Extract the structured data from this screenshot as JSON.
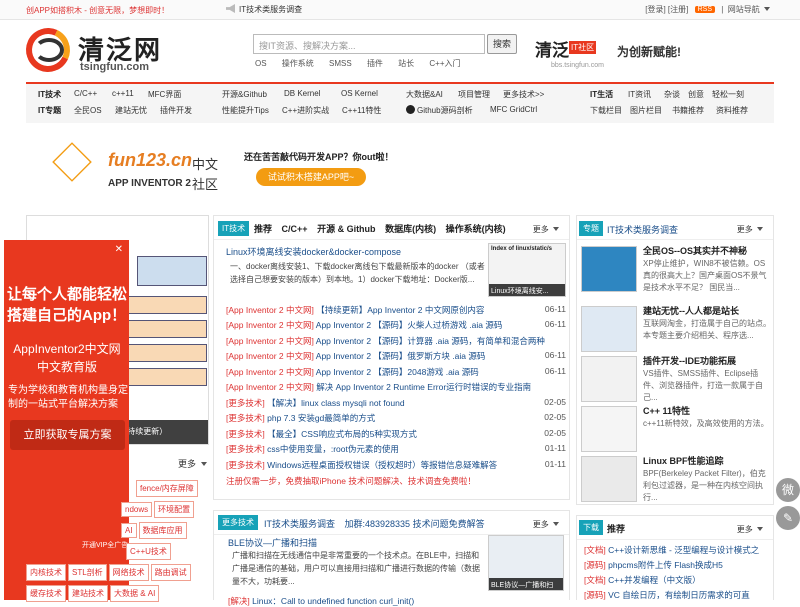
{
  "topbar": {
    "promo": "创APP如搭积木 - 创意无限，梦想即时！",
    "survey": "IT技术类服务调查",
    "login": "[登录]",
    "register": "[注册]",
    "rss": "RSS",
    "site_nav": "网站导航"
  },
  "header": {
    "logo_cn": "清泛网",
    "logo_domain": "tsingfun.com",
    "search_placeholder": "搜IT资源、搜解决方案...",
    "search_button": "搜索",
    "hot_keywords": [
      "OS",
      "操作系统",
      "SMSS",
      "插件",
      "站长",
      "C++入门"
    ],
    "community_cn": "清泛",
    "community_tag": "IT社区",
    "community_slogan": "为创新赋能!",
    "community_url": "bbs.tsingfun.com"
  },
  "nav": {
    "row1": {
      "label": "IT技术",
      "items": [
        "C/C++",
        "c++11",
        "MFC界面",
        "开源&Github",
        "DB Kernel",
        "OS Kernel",
        "大数据&AI",
        "项目管理",
        "更多技术>>"
      ],
      "right_label": "IT生活",
      "right_items": [
        "IT资讯",
        "杂谈",
        "创意",
        "轻松一刻"
      ]
    },
    "row2": {
      "label": "IT专题",
      "items": [
        "全民OS",
        "建站无忧",
        "插件开发",
        "性能提升Tips",
        "C++进阶实战",
        "C++11特性",
        "Github源码剖析",
        "MFC GridCtrl"
      ],
      "right_items": [
        "下载栏目",
        "图片栏目",
        "书籍推荐",
        "资料推荐"
      ]
    }
  },
  "banner": {
    "brand": "fun123.cn",
    "brand_sub": "APP INVENTOR 2",
    "cn1": "中文",
    "cn2": "社区",
    "question": "还在苦苦敲代码开发APP？你out啦！",
    "button": "试试积木搭建APP吧~"
  },
  "left": {
    "image_caption": "Linux bpftrace学习笔记（持续更新）",
    "more": "更多",
    "tags": [
      "fence/内存屏障",
      "ndows",
      "环境配置",
      "AI",
      "数据库应用",
      "C++U技术",
      "内核技术",
      "STL剖析",
      "网络技术",
      "路由调试",
      "缓存技术",
      "建站技术",
      "大数据 & AI"
    ]
  },
  "ad": {
    "line1": "让每个人都能轻松搭建自己的App！",
    "line2": "AppInventor2中文网",
    "line3": "中文教育版",
    "line4": "专为学校和教育机构量身定制的一站式平台解决方案",
    "cta": "立即获取专属方案",
    "vip": "开通VIP全广告"
  },
  "main": {
    "badge": "IT技术",
    "tabs": [
      "推荐",
      "C/C++",
      "开源 & Github",
      "数据库(内核)",
      "操作系统(内核)"
    ],
    "more": "更多",
    "lead_title": "Linux环境离线安装docker&docker-compose",
    "lead_summary": "一、docker离线安装1、下载docker离线包下载最新版本的docker （或者选择自己想要安装的版本）到本地。1）docker下载地址：Docker版...",
    "thumb_caption": "Linux环境离线安...",
    "thumb_title": "Index of linux/static/s",
    "items": [
      {
        "cat": "[App Inventor 2 中文网]",
        "title": "【持续更新】App Inventor 2 中文网原创内容",
        "date": "06-11"
      },
      {
        "cat": "[App Inventor 2 中文网]",
        "title": "App Inventor 2 【源码】火柴人过桥游戏 .aia 源码",
        "date": "06-11"
      },
      {
        "cat": "[App Inventor 2 中文网]",
        "title": "App Inventor 2 【源码】计算器 .aia 源码，有简单和混合两种",
        "date": ""
      },
      {
        "cat": "[App Inventor 2 中文网]",
        "title": "App Inventor 2 【源码】俄罗斯方块 .aia 源码",
        "date": "06-11"
      },
      {
        "cat": "[App Inventor 2 中文网]",
        "title": "App Inventor 2 【源码】2048游戏 .aia 源码",
        "date": "06-11"
      },
      {
        "cat": "[App Inventor 2 中文网]",
        "title": "解决 App Inventor 2 Runtime Error运行时错误的专业指南",
        "date": ""
      },
      {
        "cat": "[更多技术]",
        "title": "【解决】linux class mysqli not found",
        "date": "02-05"
      },
      {
        "cat": "[更多技术]",
        "title": "php 7.3 安装gd最简单的方式",
        "date": "02-05"
      },
      {
        "cat": "[更多技术]",
        "title": "【最全】CSS响应式布局的5种实现方式",
        "date": "02-05"
      },
      {
        "cat": "[更多技术]",
        "title": "css中使用变量，:root伪元素的使用",
        "date": "01-11"
      },
      {
        "cat": "[更多技术]",
        "title": "Windows远程桌面授权错误（授权超时）等报错信息疑难解答",
        "date": "01-11"
      }
    ],
    "notice": "注册仅需一步，免费抽取iPhone  技术问题解决、技术调查免费啦！"
  },
  "section2": {
    "badge": "更多技术",
    "tabs": [
      "IT技术类服务调查",
      "加群:483928335 技术问题免费解答"
    ],
    "more": "更多",
    "lead_title": "BLE协议—广播和扫描",
    "lead_summary": "广播和扫描在无线通信中是非常重要的一个技术点。在BLE中，扫描和广播是通信的基础，用户可以直接用扫描和广播进行数据的传输（数据量不大，功耗要...",
    "thumb_caption": "BLE协议—广播和扫",
    "next_cat": "[解决]",
    "next_title": "Linux：Call to undefined function curl_init()"
  },
  "right": {
    "badge": "专题",
    "title": "IT技术类服务调查",
    "more": "更多",
    "items": [
      {
        "title": "全民OS--OS其实并不神秘",
        "desc": "XP停止维护，WIN8不被信赖。OS真的很高大上？国产桌面OS不景气是技术水平不足？ 国民当..."
      },
      {
        "title": "建站无忧--人人都是站长",
        "desc": "互联网淘金，打造属于自己的站点。本专题主要介绍相关、程序选..."
      },
      {
        "title": "插件开发--IDE功能拓展",
        "desc": "VS插件、SMSS插件、Eclipse插件、浏览器插件，打造一款属于自己..."
      },
      {
        "title": "C++ 11特性",
        "desc": "c++11新特效，及高效使用的方法。"
      },
      {
        "title": "Linux BPF性能追踪",
        "desc": "BPF(Berkeley Packet Filter)，伯克利包过滤器，是一种在内核空间执行..."
      }
    ],
    "download_badge": "下载",
    "download_tab": "推荐",
    "downloads": [
      {
        "cat": "[文档]",
        "title": "C++设计新思维 - 泛型编程与设计模式之"
      },
      {
        "cat": "[源码]",
        "title": "phpcms附件上传 Flash换成H5"
      },
      {
        "cat": "[文档]",
        "title": "C++并发编程（中文版）"
      },
      {
        "cat": "[源码]",
        "title": "VC 自绘日历，有绘制日历需求的可直"
      }
    ]
  },
  "fab": {
    "wechat": "微",
    "edit": "✎"
  }
}
